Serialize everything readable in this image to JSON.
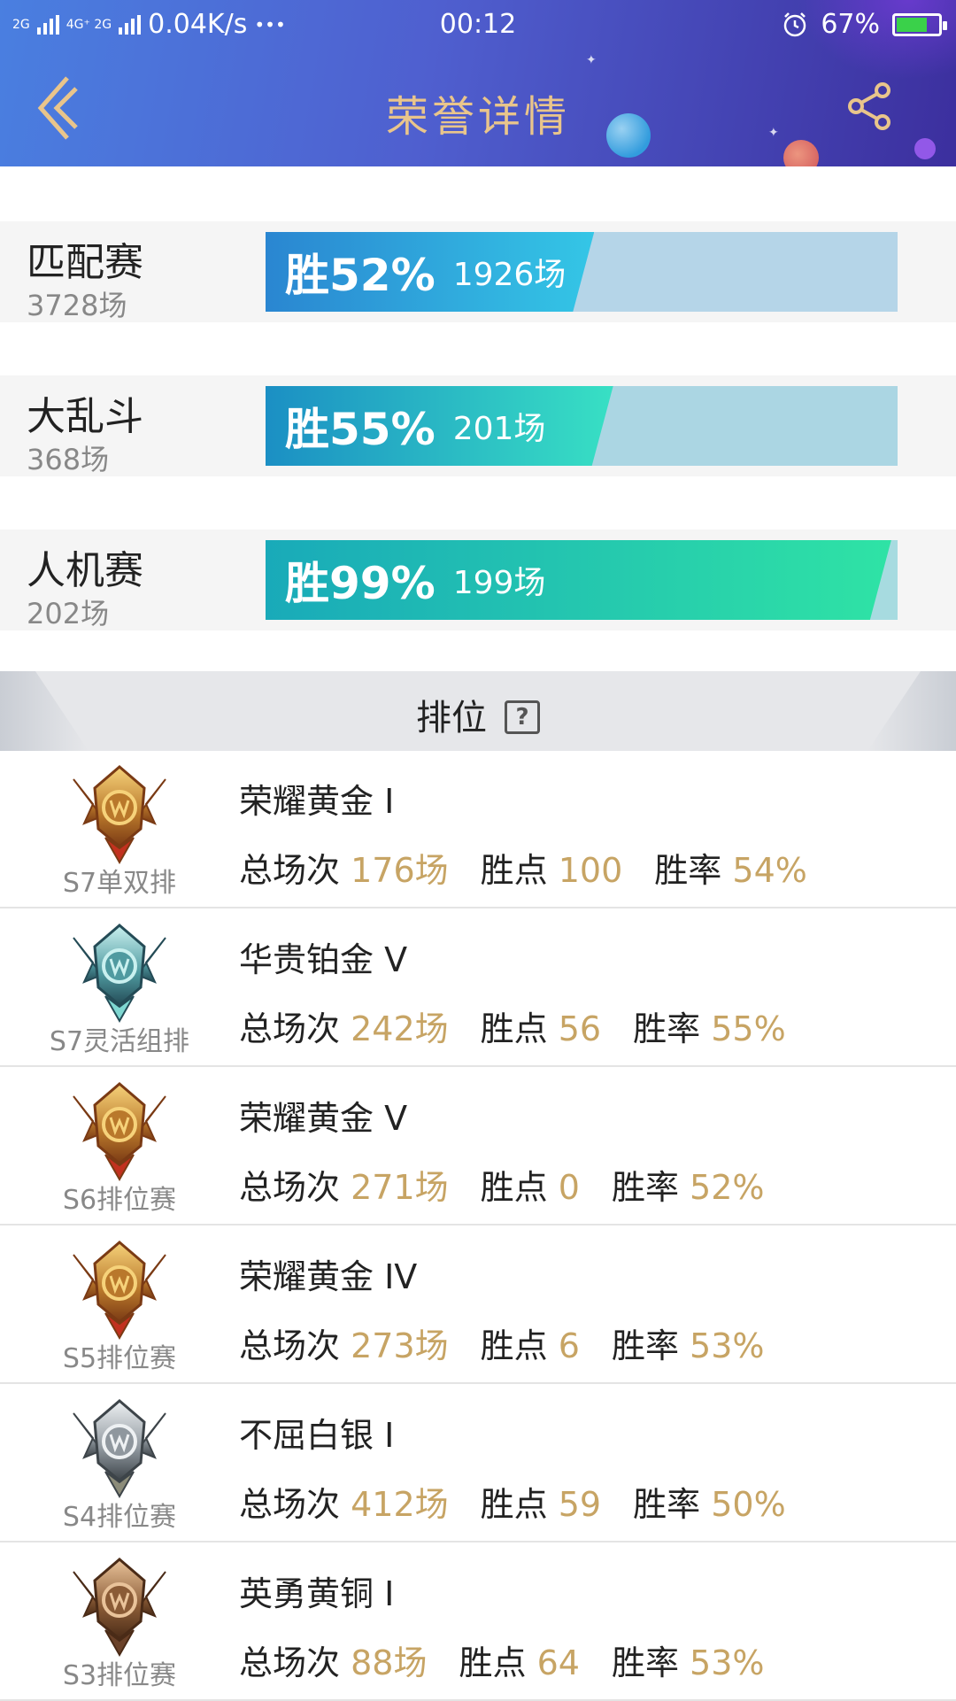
{
  "status_bar": {
    "network_left": "2G",
    "network_mid": "4G⁺",
    "network_mid2": "4G⁺ 2G",
    "speed": "0.04K/s",
    "dots": "•••",
    "time": "00:12",
    "battery": "67%"
  },
  "header": {
    "title": "荣誉详情"
  },
  "modes": [
    {
      "name": "匹配赛",
      "count": "3728场",
      "win_pct": "胜52%",
      "win_games": "1926场",
      "rate": 0.52,
      "color_from": "#2a86d1",
      "color_to": "#34c6e6",
      "track": "#b5d5e8"
    },
    {
      "name": "大乱斗",
      "count": "368场",
      "win_pct": "胜55%",
      "win_games": "201场",
      "rate": 0.55,
      "color_from": "#1b8fc4",
      "color_to": "#38e0c4",
      "track": "#abd6e3"
    },
    {
      "name": "人机赛",
      "count": "202场",
      "win_pct": "胜99%",
      "win_games": "199场",
      "rate": 0.99,
      "color_from": "#19aab9",
      "color_to": "#2fe3a5",
      "track": "#a7dbe0"
    }
  ],
  "ranking": {
    "title": "排位",
    "help": "?"
  },
  "seasons": [
    {
      "label": "S7单双排",
      "tier": "荣耀黄金 I",
      "total_label": "总场次",
      "total": "176场",
      "points_label": "胜点",
      "points": "100",
      "rate_label": "胜率",
      "rate": "54%",
      "badge": "gold"
    },
    {
      "label": "S7灵活组排",
      "tier": "华贵铂金 V",
      "total_label": "总场次",
      "total": "242场",
      "points_label": "胜点",
      "points": "56",
      "rate_label": "胜率",
      "rate": "55%",
      "badge": "platinum"
    },
    {
      "label": "S6排位赛",
      "tier": "荣耀黄金 V",
      "total_label": "总场次",
      "total": "271场",
      "points_label": "胜点",
      "points": "0",
      "rate_label": "胜率",
      "rate": "52%",
      "badge": "gold"
    },
    {
      "label": "S5排位赛",
      "tier": "荣耀黄金 IV",
      "total_label": "总场次",
      "total": "273场",
      "points_label": "胜点",
      "points": "6",
      "rate_label": "胜率",
      "rate": "53%",
      "badge": "gold"
    },
    {
      "label": "S4排位赛",
      "tier": "不屈白银 I",
      "total_label": "总场次",
      "total": "412场",
      "points_label": "胜点",
      "points": "59",
      "rate_label": "胜率",
      "rate": "50%",
      "badge": "silver"
    },
    {
      "label": "S3排位赛",
      "tier": "英勇黄铜 I",
      "total_label": "总场次",
      "total": "88场",
      "points_label": "胜点",
      "points": "64",
      "rate_label": "胜率",
      "rate": "53%",
      "badge": "bronze"
    }
  ]
}
